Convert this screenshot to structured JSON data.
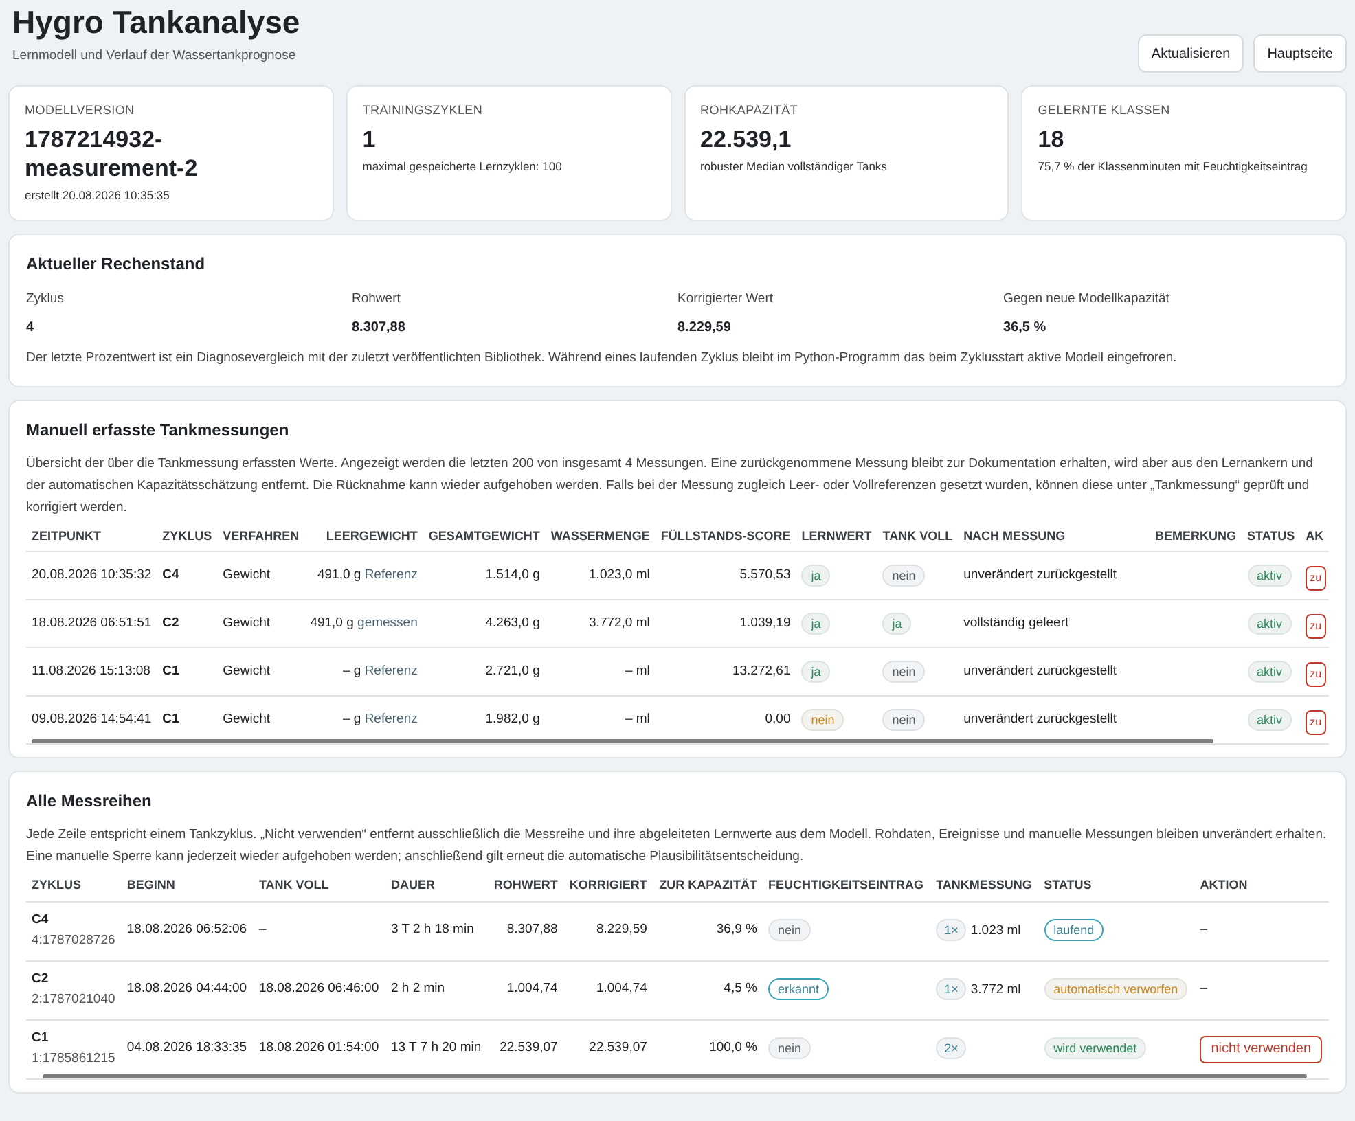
{
  "header": {
    "title": "Hygro Tankanalyse",
    "subtitle": "Lernmodell und Verlauf der Wassertankprognose",
    "buttons": [
      "Aktualisieren",
      "Hauptseite"
    ]
  },
  "stats": [
    {
      "label": "MODELLVERSION",
      "value": "1787214932-measurement-2",
      "note": "erstellt 20.08.2026 10:35:35"
    },
    {
      "label": "TRAININGSZYKLEN",
      "value": "1",
      "note": "maximal gespeicherte Lernzyklen: 100"
    },
    {
      "label": "ROHKAPAZITÄT",
      "value": "22.539,1",
      "note": "robuster Median vollständiger Tanks"
    },
    {
      "label": "GELERNTE KLASSEN",
      "value": "18",
      "note": "75,7 % der Klassenminuten mit Feuchtigkeitseintrag"
    }
  ],
  "current": {
    "title": "Aktueller Rechenstand",
    "fields": [
      {
        "label": "Zyklus",
        "value": "4"
      },
      {
        "label": "Rohwert",
        "value": "8.307,88"
      },
      {
        "label": "Korrigierter Wert",
        "value": "8.229,59"
      },
      {
        "label": "Gegen neue Modellkapazität",
        "value": "36,5 %"
      }
    ],
    "note": "Der letzte Prozentwert ist ein Diagnosevergleich mit der zuletzt veröffentlichten Bibliothek. Während eines laufenden Zyklus bleibt im Python-Programm das beim Zyklusstart aktive Modell eingefroren."
  },
  "measurements": {
    "title": "Manuell erfasste Tankmessungen",
    "description": "Übersicht der über die Tankmessung erfassten Werte. Angezeigt werden die letzten 200 von insgesamt 4 Messungen. Eine zurückgenommene Messung bleibt zur Dokumentation erhalten, wird aber aus den Lernankern und der automatischen Kapazitätsschätzung entfernt. Die Rücknahme kann wieder aufgehoben werden. Falls bei der Messung zugleich Leer- oder Vollreferenzen gesetzt wurden, können diese unter „Tankmessung“ geprüft und korrigiert werden.",
    "columns": [
      "ZEITPUNKT",
      "ZYKLUS",
      "VERFAHREN",
      "LEERGEWICHT",
      "GESAMTGEWICHT",
      "WASSERMENGE",
      "FÜLLSTANDS-SCORE",
      "LERNWERT",
      "TANK VOLL",
      "NACH MESSUNG",
      "BEMERKUNG",
      "STATUS",
      "AK"
    ],
    "rows": [
      {
        "time": "20.08.2026 10:35:32",
        "cycle": "C4",
        "method": "Gewicht",
        "empty": "491,0 g",
        "empty_source": "Referenz",
        "total": "1.514,0 g",
        "water": "1.023,0 ml",
        "score": "5.570,53",
        "learn": {
          "text": "ja",
          "kind": "positive"
        },
        "full": {
          "text": "nein",
          "kind": "neutral"
        },
        "after": "unverändert zurückgestellt",
        "status": {
          "text": "aktiv",
          "kind": "positive"
        },
        "action": "zu"
      },
      {
        "time": "18.08.2026 06:51:51",
        "cycle": "C2",
        "method": "Gewicht",
        "empty": "491,0 g",
        "empty_source": "gemessen",
        "total": "4.263,0 g",
        "water": "3.772,0 ml",
        "score": "1.039,19",
        "learn": {
          "text": "ja",
          "kind": "positive"
        },
        "full": {
          "text": "ja",
          "kind": "positive"
        },
        "after": "vollständig geleert",
        "status": {
          "text": "aktiv",
          "kind": "positive"
        },
        "action": "zu"
      },
      {
        "time": "11.08.2026 15:13:08",
        "cycle": "C1",
        "method": "Gewicht",
        "empty": "– g",
        "empty_source": "Referenz",
        "total": "2.721,0 g",
        "water": "– ml",
        "score": "13.272,61",
        "learn": {
          "text": "ja",
          "kind": "positive"
        },
        "full": {
          "text": "nein",
          "kind": "neutral"
        },
        "after": "unverändert zurückgestellt",
        "status": {
          "text": "aktiv",
          "kind": "positive"
        },
        "action": "zu"
      },
      {
        "time": "09.08.2026 14:54:41",
        "cycle": "C1",
        "method": "Gewicht",
        "empty": "– g",
        "empty_source": "Referenz",
        "total": "1.982,0 g",
        "water": "– ml",
        "score": "0,00",
        "learn": {
          "text": "nein",
          "kind": "warning"
        },
        "full": {
          "text": "nein",
          "kind": "neutral"
        },
        "after": "unverändert zurückgestellt",
        "status": {
          "text": "aktiv",
          "kind": "positive"
        },
        "action": "zu"
      }
    ]
  },
  "series": {
    "title": "Alle Messreihen",
    "description": "Jede Zeile entspricht einem Tankzyklus. „Nicht verwenden“ entfernt ausschließlich die Messreihe und ihre abgeleiteten Lernwerte aus dem Modell. Rohdaten, Ereignisse und manuelle Messungen bleiben unverändert erhalten. Eine manuelle Sperre kann jederzeit wieder aufgehoben werden; anschließend gilt erneut die automatische Plausibilitätsentscheidung.",
    "columns": [
      "ZYKLUS",
      "BEGINN",
      "TANK VOLL",
      "DAUER",
      "ROHWERT",
      "KORRIGIERT",
      "ZUR KAPAZITÄT",
      "FEUCHTIGKEITSEINTRAG",
      "TANKMESSUNG",
      "STATUS",
      "AKTION"
    ],
    "rows": [
      {
        "cycle": "C4",
        "cycle_id": "4:1787028726",
        "start": "18.08.2026 06:52:06",
        "full": "–",
        "duration": "3 T 2 h 18 min",
        "raw": "8.307,88",
        "corrected": "8.229,59",
        "capacity": "36,9 %",
        "humidity": {
          "text": "nein",
          "kind": "neutral"
        },
        "count": "1×",
        "measured": "1.023 ml",
        "status": {
          "text": "laufend",
          "kind": "info"
        },
        "action": {
          "kind": "text",
          "text": "–"
        }
      },
      {
        "cycle": "C2",
        "cycle_id": "2:1787021040",
        "start": "18.08.2026 04:44:00",
        "full": "18.08.2026 06:46:00",
        "duration": "2 h 2 min",
        "raw": "1.004,74",
        "corrected": "1.004,74",
        "capacity": "4,5 %",
        "humidity": {
          "text": "erkannt",
          "kind": "info"
        },
        "count": "1×",
        "measured": "3.772 ml",
        "status": {
          "text": "automatisch verworfen",
          "kind": "warning"
        },
        "action": {
          "kind": "text",
          "text": "–"
        }
      },
      {
        "cycle": "C1",
        "cycle_id": "1:1785861215",
        "start": "04.08.2026 18:33:35",
        "full": "18.08.2026 01:54:00",
        "duration": "13 T 7 h 20 min",
        "raw": "22.539,07",
        "corrected": "22.539,07",
        "capacity": "100,0 %",
        "humidity": {
          "text": "nein",
          "kind": "neutral"
        },
        "count": "2×",
        "status": {
          "text": "wird verwendet",
          "kind": "positive"
        },
        "action": {
          "kind": "button",
          "text": "nicht verwenden"
        }
      }
    ]
  }
}
